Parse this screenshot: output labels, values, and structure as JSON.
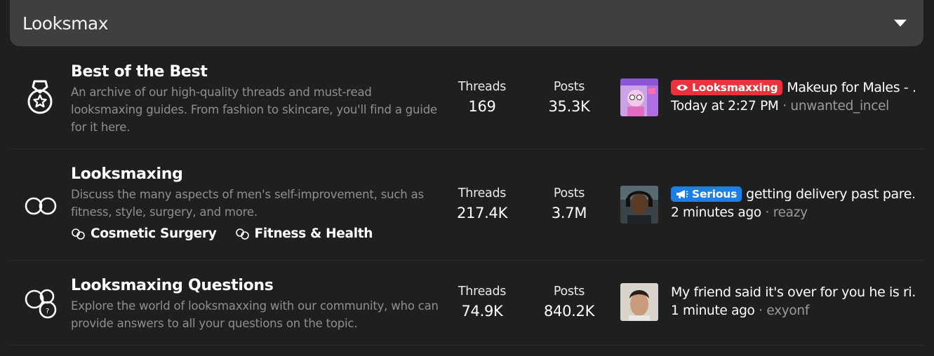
{
  "header": {
    "title": "Looksmax"
  },
  "forums": [
    {
      "title": "Best of the Best",
      "description": "An archive of our high-quality threads and must-read looksmaxing guides. From fashion to skincare, you'll find a guide for it here.",
      "threads_label": "Threads",
      "threads": "169",
      "posts_label": "Posts",
      "posts": "35.3K",
      "latest": {
        "prefix": "Looksmaxxing",
        "prefix_color": "#e8323c",
        "title": "Makeup for Males - ...",
        "time": "Today at 2:27 PM",
        "separator": "·",
        "user": "unwanted_incel"
      }
    },
    {
      "title": "Looksmaxing",
      "description": "Discuss the many aspects of men's self-improvement, such as fitness, style, surgery, and more.",
      "threads_label": "Threads",
      "threads": "217.4K",
      "posts_label": "Posts",
      "posts": "3.7M",
      "subforums": [
        "Cosmetic Surgery",
        "Fitness & Health"
      ],
      "latest": {
        "prefix": "Serious",
        "prefix_color": "#1d7ee8",
        "title": "getting delivery past pare...",
        "time": "2 minutes ago",
        "separator": "·",
        "user": "reazy"
      }
    },
    {
      "title": "Looksmaxing Questions",
      "description": "Explore the world of looksmaxxing with our community, who can provide answers to all your questions on the topic.",
      "threads_label": "Threads",
      "threads": "74.9K",
      "posts_label": "Posts",
      "posts": "840.2K",
      "latest": {
        "title": "My friend said it's over for you he is ri...",
        "time": "1 minute ago",
        "separator": "·",
        "user": "exyonf"
      }
    }
  ]
}
